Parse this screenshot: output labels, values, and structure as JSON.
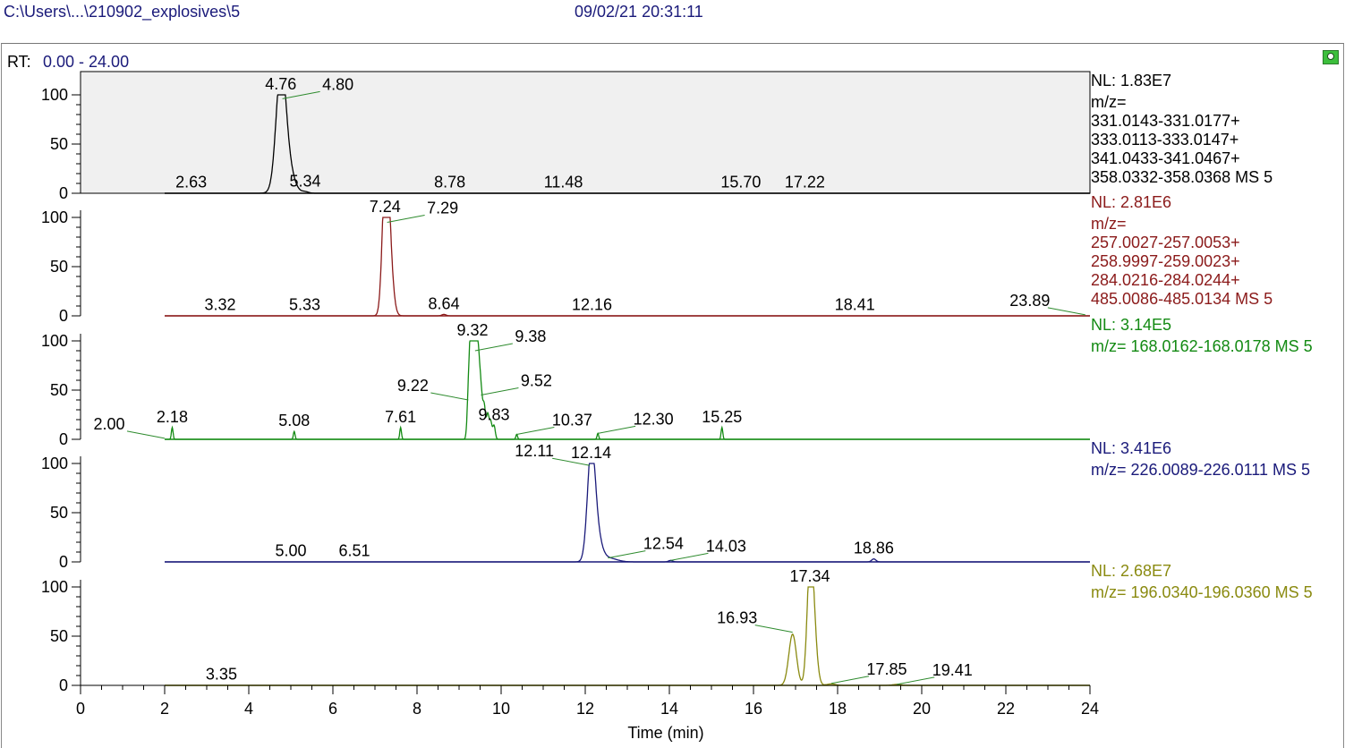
{
  "header": {
    "file_path": "C:\\Users\\...\\210902_explosives\\5",
    "timestamp": "09/02/21 20:31:11"
  },
  "panel": {
    "rt_label": "RT:",
    "rt_range": "0.00 - 24.00",
    "corner_button": "green-circle-icon"
  },
  "chart_data": {
    "type": "line",
    "xlabel": "Time (min)",
    "xlim": [
      0,
      24
    ],
    "x_ticks": [
      "0",
      "2",
      "4",
      "6",
      "8",
      "10",
      "12",
      "14",
      "16",
      "18",
      "20",
      "22",
      "24"
    ],
    "y_ticks": [
      "0",
      "50",
      "100"
    ],
    "ylim": [
      0,
      100
    ],
    "traces": [
      {
        "color": "#000000",
        "highlighted": true,
        "nl": "NL: 1.83E7",
        "mz_lines": [
          "m/z=",
          "331.0143-331.0177+",
          "333.0113-333.0147+",
          "341.0433-341.0467+",
          "358.0332-358.0368  MS 5"
        ],
        "peaks": [
          {
            "x": 4.76,
            "y": 100,
            "w": 0.11
          },
          {
            "x": 4.86,
            "y": 40,
            "w": 0.16
          },
          {
            "x": 5.34,
            "y": 1.5,
            "w": 0.08
          }
        ],
        "labels": [
          {
            "text": "4.76",
            "x": 4.76,
            "y": 100,
            "style": "apex"
          },
          {
            "text": "4.80",
            "x": 4.8,
            "y": 96,
            "style": "leader"
          },
          {
            "text": "2.63",
            "x": 2.63,
            "y": 0.5,
            "style": "apex"
          },
          {
            "text": "5.34",
            "x": 5.34,
            "y": 1.5,
            "style": "apex"
          },
          {
            "text": "8.78",
            "x": 8.78,
            "y": 0.5,
            "style": "apex"
          },
          {
            "text": "11.48",
            "x": 11.48,
            "y": 0.5,
            "style": "apex"
          },
          {
            "text": "15.70",
            "x": 15.7,
            "y": 0.5,
            "style": "apex"
          },
          {
            "text": "17.22",
            "x": 17.22,
            "y": 0.5,
            "style": "apex"
          }
        ]
      },
      {
        "color": "#8b1a1a",
        "highlighted": false,
        "nl": "NL: 2.81E6",
        "mz_lines": [
          "m/z=",
          "257.0027-257.0053+",
          "258.9997-259.0023+",
          "284.0216-284.0244+",
          "485.0086-485.0134  MS 5"
        ],
        "peaks": [
          {
            "x": 7.24,
            "y": 100,
            "w": 0.07
          },
          {
            "x": 7.3,
            "y": 80,
            "w": 0.08
          },
          {
            "x": 7.38,
            "y": 20,
            "w": 0.08
          },
          {
            "x": 8.64,
            "y": 1.5,
            "w": 0.05
          }
        ],
        "labels": [
          {
            "text": "7.24",
            "x": 7.24,
            "y": 100,
            "style": "apex"
          },
          {
            "text": "7.29",
            "x": 7.29,
            "y": 95,
            "style": "leader"
          },
          {
            "text": "3.32",
            "x": 3.32,
            "y": 0.5,
            "style": "apex"
          },
          {
            "text": "5.33",
            "x": 5.33,
            "y": 0.5,
            "style": "apex"
          },
          {
            "text": "8.64",
            "x": 8.64,
            "y": 1.5,
            "style": "apex"
          },
          {
            "text": "12.16",
            "x": 12.16,
            "y": 0.5,
            "style": "apex"
          },
          {
            "text": "18.41",
            "x": 18.41,
            "y": 0.5,
            "style": "apex"
          },
          {
            "text": "23.89",
            "x": 23.89,
            "y": 1,
            "style": "leftleader"
          }
        ]
      },
      {
        "color": "#138a13",
        "highlighted": false,
        "nl": "NL: 3.14E5",
        "mz_lines": [
          "m/z= 168.0162-168.0178  MS 5"
        ],
        "peaks": [
          {
            "x": 9.32,
            "y": 100,
            "w": 0.04
          },
          {
            "x": 9.38,
            "y": 85,
            "w": 0.05
          },
          {
            "x": 9.28,
            "y": 70,
            "w": 0.04
          },
          {
            "x": 9.45,
            "y": 60,
            "w": 0.04
          },
          {
            "x": 9.52,
            "y": 45,
            "w": 0.04
          },
          {
            "x": 9.6,
            "y": 30,
            "w": 0.03
          },
          {
            "x": 9.68,
            "y": 25,
            "w": 0.03
          },
          {
            "x": 9.75,
            "y": 18,
            "w": 0.03
          },
          {
            "x": 9.83,
            "y": 14,
            "w": 0.03
          },
          {
            "x": 9.22,
            "y": 35,
            "w": 0.03
          },
          {
            "x": 2.18,
            "y": 12,
            "w": 0.02
          },
          {
            "x": 5.08,
            "y": 8,
            "w": 0.02
          },
          {
            "x": 7.61,
            "y": 12,
            "w": 0.02
          },
          {
            "x": 10.37,
            "y": 5,
            "w": 0.02
          },
          {
            "x": 12.3,
            "y": 6,
            "w": 0.02
          },
          {
            "x": 15.25,
            "y": 12,
            "w": 0.02
          }
        ],
        "labels": [
          {
            "text": "9.32",
            "x": 9.32,
            "y": 100,
            "style": "apex"
          },
          {
            "text": "9.38",
            "x": 9.38,
            "y": 90,
            "style": "leader"
          },
          {
            "text": "9.22",
            "x": 9.22,
            "y": 40,
            "style": "leftleader"
          },
          {
            "text": "9.52",
            "x": 9.52,
            "y": 45,
            "style": "leader"
          },
          {
            "text": "9.83",
            "x": 9.83,
            "y": 14,
            "style": "apex"
          },
          {
            "text": "10.37",
            "x": 10.37,
            "y": 5,
            "style": "leader"
          },
          {
            "text": "12.30",
            "x": 12.3,
            "y": 6,
            "style": "leader"
          },
          {
            "text": "2.00",
            "x": 2.0,
            "y": 1,
            "style": "leftleader"
          },
          {
            "text": "2.18",
            "x": 2.18,
            "y": 12,
            "style": "apex"
          },
          {
            "text": "5.08",
            "x": 5.08,
            "y": 8,
            "style": "apex"
          },
          {
            "text": "7.61",
            "x": 7.61,
            "y": 12,
            "style": "apex"
          },
          {
            "text": "15.25",
            "x": 15.25,
            "y": 12,
            "style": "apex"
          }
        ]
      },
      {
        "color": "#1a1a7a",
        "highlighted": false,
        "nl": "NL: 3.41E6",
        "mz_lines": [
          "m/z= 226.0089-226.0111  MS 5"
        ],
        "peaks": [
          {
            "x": 12.14,
            "y": 100,
            "w": 0.09
          },
          {
            "x": 12.25,
            "y": 30,
            "w": 0.12
          },
          {
            "x": 12.54,
            "y": 4,
            "w": 0.2
          },
          {
            "x": 14.03,
            "y": 1.5,
            "w": 0.05
          },
          {
            "x": 18.86,
            "y": 3,
            "w": 0.05
          }
        ],
        "labels": [
          {
            "text": "12.14",
            "x": 12.14,
            "y": 100,
            "style": "apex"
          },
          {
            "text": "12.11",
            "x": 12.11,
            "y": 98,
            "style": "leftleader"
          },
          {
            "text": "5.00",
            "x": 5.0,
            "y": 0.5,
            "style": "apex"
          },
          {
            "text": "6.51",
            "x": 6.51,
            "y": 0.5,
            "style": "apex"
          },
          {
            "text": "12.54",
            "x": 12.54,
            "y": 4,
            "style": "leader"
          },
          {
            "text": "14.03",
            "x": 14.03,
            "y": 1.5,
            "style": "leader"
          },
          {
            "text": "18.86",
            "x": 18.86,
            "y": 3,
            "style": "apex"
          }
        ]
      },
      {
        "color": "#8a8a10",
        "highlighted": false,
        "nl": "NL: 2.68E7",
        "mz_lines": [
          "m/z= 196.0340-196.0360  MS 5"
        ],
        "peaks": [
          {
            "x": 17.34,
            "y": 100,
            "w": 0.07
          },
          {
            "x": 17.42,
            "y": 60,
            "w": 0.08
          },
          {
            "x": 16.93,
            "y": 52,
            "w": 0.09
          },
          {
            "x": 17.85,
            "y": 1.5,
            "w": 0.1
          },
          {
            "x": 19.41,
            "y": 1,
            "w": 0.1
          }
        ],
        "labels": [
          {
            "text": "17.34",
            "x": 17.34,
            "y": 100,
            "style": "apex"
          },
          {
            "text": "16.93",
            "x": 16.93,
            "y": 54,
            "style": "leftleader"
          },
          {
            "text": "3.35",
            "x": 3.35,
            "y": 0.5,
            "style": "apex"
          },
          {
            "text": "17.85",
            "x": 17.85,
            "y": 2,
            "style": "leader"
          },
          {
            "text": "19.41",
            "x": 19.41,
            "y": 1,
            "style": "leader"
          }
        ]
      }
    ]
  }
}
